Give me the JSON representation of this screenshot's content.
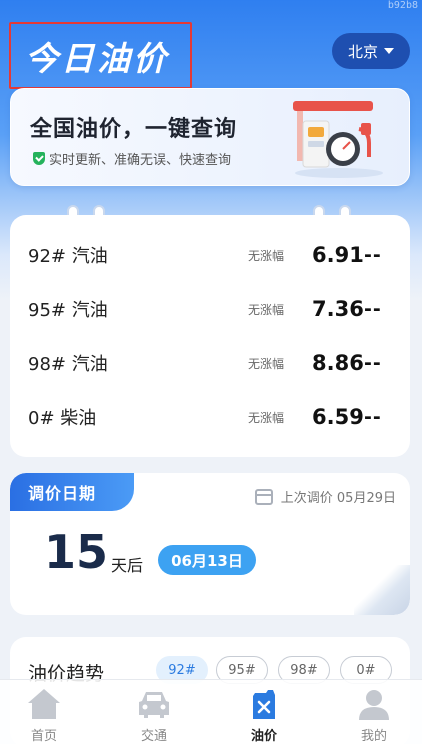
{
  "watermark": "b92b8",
  "header": {
    "title": "今日油价",
    "city": "北京"
  },
  "banner": {
    "headline": "全国油价，一键查询",
    "subline": "实时更新、准确无误、快速查询"
  },
  "prices": [
    {
      "name": "92# 汽油",
      "change": "无涨幅",
      "value": "6.91",
      "trend": "--"
    },
    {
      "name": "95# 汽油",
      "change": "无涨幅",
      "value": "7.36",
      "trend": "--"
    },
    {
      "name": "98# 汽油",
      "change": "无涨幅",
      "value": "8.86",
      "trend": "--"
    },
    {
      "name": "0# 柴油",
      "change": "无涨幅",
      "value": "6.59",
      "trend": "--"
    }
  ],
  "adjust": {
    "tag": "调价日期",
    "last": "上次调价 05月29日",
    "days": "15",
    "after": "天后",
    "date": "06月13日"
  },
  "trend": {
    "title": "油价趋势",
    "chips": [
      "92#",
      "95#",
      "98#",
      "0#"
    ],
    "selected": "92#"
  },
  "tabs": [
    {
      "label": "首页",
      "icon": "home-icon"
    },
    {
      "label": "交通",
      "icon": "car-icon"
    },
    {
      "label": "油价",
      "icon": "fuel-can-icon"
    },
    {
      "label": "我的",
      "icon": "person-icon"
    }
  ],
  "colors": {
    "primary": "#2f7ff0",
    "accent": "#3da2f2",
    "alert": "#e53935",
    "success": "#25b25c"
  }
}
